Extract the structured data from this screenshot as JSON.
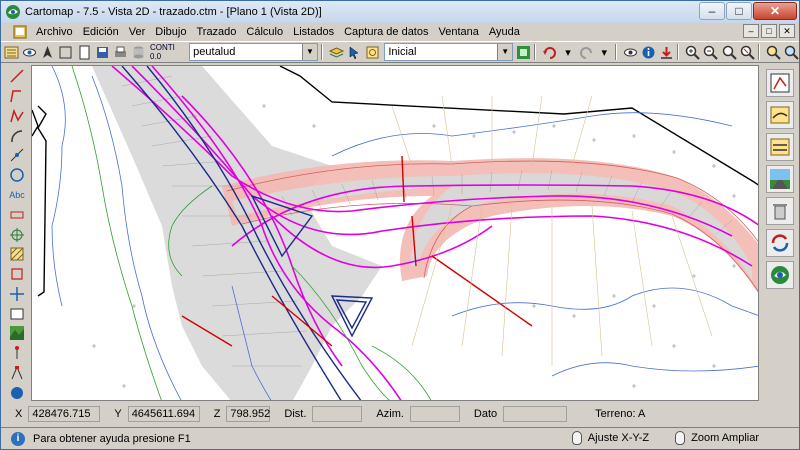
{
  "window": {
    "title": "Cartomap - 7.5 - Vista 2D - trazado.ctm - [Plano 1 (Vista 2D)]",
    "minimize_glyph": "–",
    "maximize_glyph": "□",
    "close_glyph": "✕"
  },
  "menu": {
    "items": [
      "Archivo",
      "Edición",
      "Ver",
      "Dibujo",
      "Trazado",
      "Cálculo",
      "Listados",
      "Captura de datos",
      "Ventana",
      "Ayuda"
    ]
  },
  "toolbar": {
    "layer_tag_top": "CONTI",
    "layer_tag_line": "0.0",
    "layer_name": "peutalud",
    "view_name": "Inicial"
  },
  "coords": {
    "x_label": "X",
    "x_value": "428476.715",
    "y_label": "Y",
    "y_value": "4645611.694",
    "z_label": "Z",
    "z_value": "798.952",
    "dist_label": "Dist.",
    "dist_value": "",
    "azim_label": "Azim.",
    "azim_value": "",
    "dato_label": "Dato",
    "dato_value": "",
    "terreno_label": "Terreno: A"
  },
  "status": {
    "help_text": "Para obtener ayuda presione F1",
    "action_left": "Ajuste X-Y-Z",
    "action_right": "Zoom Ampliar"
  },
  "colors": {
    "alignment": "#e000e0",
    "road_band": "#f2b8b0",
    "road_gray": "#cfcfcf",
    "contour_blue": "#4a6fd0",
    "contour_green": "#30a030",
    "red_line": "#d00000",
    "boundary": "#000000"
  }
}
